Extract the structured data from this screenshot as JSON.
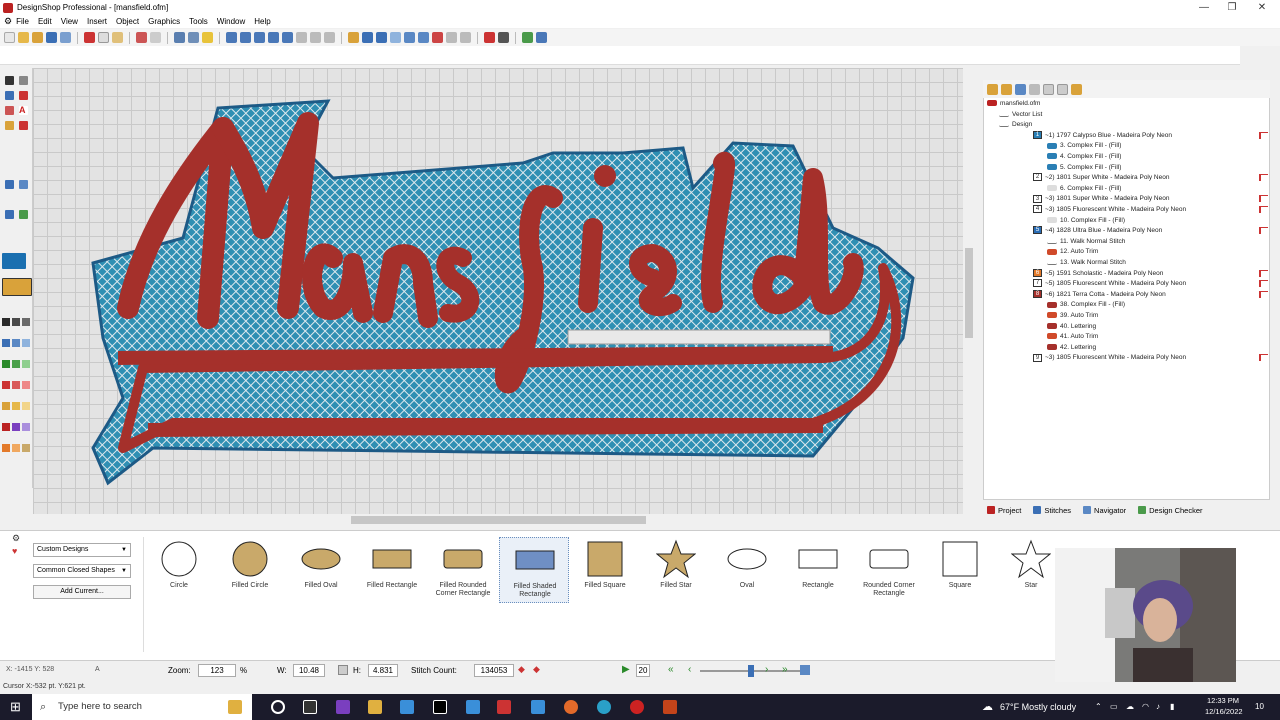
{
  "window": {
    "title": "DesignShop Professional - [mansfield.ofm]",
    "controls": [
      "—",
      "❐",
      "✕"
    ]
  },
  "menu": [
    "File",
    "Edit",
    "View",
    "Insert",
    "Object",
    "Graphics",
    "Tools",
    "Window",
    "Help"
  ],
  "design": {
    "text": "Mansfield",
    "thread_color": "#a5302b",
    "fill_color": "#2f8fb3",
    "outline_color": "#1d5a86"
  },
  "layers": {
    "file": "mansfield.ofm",
    "rows": [
      {
        "label": "Vector List",
        "indent": 1
      },
      {
        "label": "Design",
        "indent": 1
      },
      {
        "swatch": "1",
        "label": "~1) 1797 Calypso Blue - Madeira Poly Neon",
        "indent": 2,
        "color": "#2a7fb5"
      },
      {
        "label": "3. Complex Fill - (Fill)",
        "indent": 3,
        "color": "#2a7fb5"
      },
      {
        "label": "4. Complex Fill - (Fill)",
        "indent": 3,
        "color": "#2a7fb5"
      },
      {
        "label": "5. Complex Fill - (Fill)",
        "indent": 3,
        "color": "#2a7fb5"
      },
      {
        "swatch": "2",
        "label": "~2) 1801 Super White - Madeira Poly Neon",
        "indent": 2,
        "color": "#ffffff"
      },
      {
        "label": "6. Complex Fill - (Fill)",
        "indent": 3,
        "color": "#dddddd"
      },
      {
        "swatch": "3",
        "label": "~3) 1801 Super White - Madeira Poly Neon",
        "indent": 2,
        "color": "#ffffff"
      },
      {
        "swatch": "4",
        "label": "~3) 1805 Fluorescent White - Madeira Poly Neon",
        "indent": 2,
        "color": "#ffffff"
      },
      {
        "label": "10. Complex Fill - (Fill)",
        "indent": 3,
        "color": "#dddddd"
      },
      {
        "swatch": "5",
        "label": "~4) 1828 Ultra Blue - Madeira Poly Neon",
        "indent": 2,
        "color": "#2a6db5"
      },
      {
        "label": "11. Walk Normal Stitch",
        "indent": 3,
        "color": ""
      },
      {
        "label": "12. Auto Trim",
        "indent": 3,
        "color": "#d04a2a"
      },
      {
        "label": "13. Walk Normal Stitch",
        "indent": 3,
        "color": ""
      },
      {
        "swatch": "6",
        "label": "~5) 1591 Scholastic - Madeira Poly Neon",
        "indent": 2,
        "color": "#e37a2a"
      },
      {
        "swatch": "7",
        "label": "~5) 1805 Fluorescent White - Madeira Poly Neon",
        "indent": 2,
        "color": "#ffffff"
      },
      {
        "swatch": "8",
        "label": "~6) 1821 Terra Cotta - Madeira Poly Neon",
        "indent": 2,
        "color": "#a5302b"
      },
      {
        "label": "38. Complex Fill - (Fill)",
        "indent": 3,
        "color": "#a5302b"
      },
      {
        "label": "39. Auto Trim",
        "indent": 3,
        "color": "#d04a2a"
      },
      {
        "label": "40. Lettering",
        "indent": 3,
        "color": "#a5302b"
      },
      {
        "label": "41. Auto Trim",
        "indent": 3,
        "color": "#d04a2a"
      },
      {
        "label": "42. Lettering",
        "indent": 3,
        "color": "#a5302b"
      },
      {
        "swatch": "9",
        "label": "~3) 1805 Fluorescent White - Madeira Poly Neon",
        "indent": 2,
        "color": "#ffffff"
      }
    ]
  },
  "panel_tabs": [
    "Project",
    "Stitches",
    "Navigator",
    "Design Checker"
  ],
  "shapes": {
    "category": "Custom Designs",
    "subcategory": "Common Closed Shapes",
    "add_button": "Add Current...",
    "items": [
      "Circle",
      "Filled Circle",
      "Filled Oval",
      "Filled Rectangle",
      "Filled Rounded Corner Rectangle",
      "Filled Shaded Rectangle",
      "Filled Square",
      "Filled Star",
      "Oval",
      "Rectangle",
      "Rounded Corner Rectangle",
      "Square",
      "Star"
    ]
  },
  "status": {
    "coords": "X: -1415  Y: 528",
    "extra": "A",
    "zoom_label": "Zoom:",
    "zoom_value": "123",
    "zoom_unit": "%",
    "w_label": "W:",
    "w_value": "10.48",
    "h_label": "H:",
    "h_value": "4.831",
    "stitch_label": "Stitch Count:",
    "stitch_value": "134053",
    "speed_value": "20",
    "cursor": "Cursor X:-532 pt. Y:621 pt."
  },
  "taskbar": {
    "search_placeholder": "Type here to search",
    "weather": "67°F  Mostly cloudy",
    "time": "12:33 PM",
    "date": "12/16/2022",
    "notif": "10"
  }
}
